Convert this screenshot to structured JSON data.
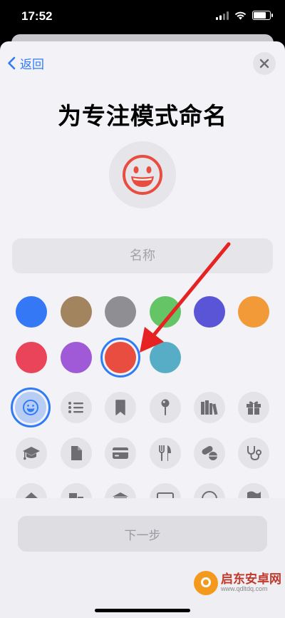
{
  "status": {
    "time": "17:52"
  },
  "nav": {
    "back_label": "返回"
  },
  "title": "为专注模式命名",
  "name_field": {
    "placeholder": "名称",
    "value": ""
  },
  "colors": [
    "#3478f6",
    "#a2845e",
    "#8e8e93",
    "#65c466",
    "#5a55d6",
    "#f19a37",
    "#e9445a",
    "#a05ad8",
    "#e94d3f",
    "#57acc6"
  ],
  "selected_color": "#e94d3f",
  "icons": [
    "smiley-icon",
    "list-icon",
    "bookmark-icon",
    "pin-icon",
    "books-icon",
    "gift-icon",
    "graduation-cap-icon",
    "document-icon",
    "credit-card-icon",
    "fork-knife-icon",
    "pills-icon",
    "stethoscope-icon",
    "house-icon",
    "building-icon",
    "bank-icon",
    "monitor-icon",
    "globe-icon",
    "flag-icon"
  ],
  "selected_icon": "smiley-icon",
  "footer": {
    "next_label": "下一步"
  },
  "watermark": {
    "name": "启东安卓网",
    "url": "www.qdltdq.com"
  }
}
